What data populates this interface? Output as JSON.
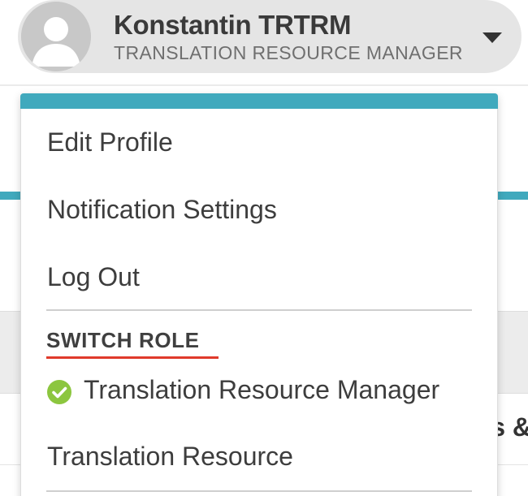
{
  "user": {
    "name": "Konstantin TRTRM",
    "role_caption": "TRANSLATION RESOURCE MANAGER"
  },
  "menu": {
    "items": [
      {
        "label": "Edit Profile"
      },
      {
        "label": "Notification Settings"
      },
      {
        "label": "Log Out"
      }
    ],
    "switch_role_heading": "SWITCH ROLE",
    "roles": [
      {
        "label": "Translation Resource Manager",
        "active": true
      },
      {
        "label": "Translation Resource",
        "active": false
      }
    ]
  },
  "background": {
    "partial_text": "s &"
  },
  "icons": {
    "avatar": "default-user-avatar-icon",
    "caret": "caret-down-icon",
    "active_role": "check-circle-icon"
  },
  "colors": {
    "accent_teal": "#40a9bd",
    "underline_red": "#e03a2b",
    "check_green": "#8cc63f",
    "chip_gray": "#e5e5e5"
  }
}
